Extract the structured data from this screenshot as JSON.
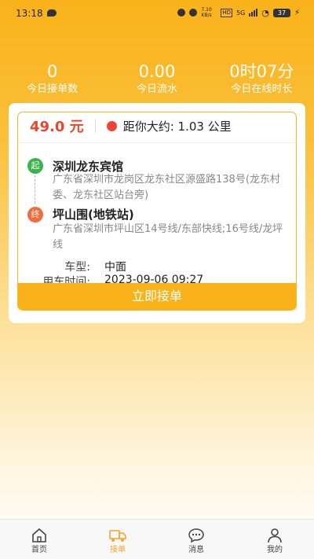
{
  "statusbar": {
    "time": "13:18",
    "net_speed": "7.10 KB/s",
    "hd": "HD",
    "network": "5G",
    "battery": "37"
  },
  "stats": [
    {
      "value": "0",
      "label": "今日接单数"
    },
    {
      "value": "0.00",
      "label": "今日流水"
    },
    {
      "value": "0时07分",
      "label": "今日在线时长"
    }
  ],
  "order": {
    "price": "49.0 元",
    "distance": "距你大约: 1.03 公里",
    "start_badge": "起",
    "start_name": "深圳龙东宾馆",
    "start_address": "广东省深圳市龙岗区龙东社区源盛路138号(龙东村委、龙东社区站台旁)",
    "end_badge": "终",
    "end_name": "坪山围(地铁站)",
    "end_address": "广东省深圳市坪山区14号线/东部快线;16号线/龙坪线",
    "vehicle_label": "车型:",
    "vehicle_value": "中面",
    "time_label": "用车时间:",
    "time_value": "2023-09-06 09:27",
    "accept_label": "立即接单"
  },
  "tabs": [
    {
      "label": "首页",
      "icon": "home-icon"
    },
    {
      "label": "接单",
      "icon": "truck-icon",
      "active": true
    },
    {
      "label": "消息",
      "icon": "message-icon"
    },
    {
      "label": "我的",
      "icon": "user-icon"
    }
  ],
  "colors": {
    "accent": "#f9b21a",
    "price": "#e8462e",
    "start": "#39b54a",
    "end": "#f26b3a"
  }
}
